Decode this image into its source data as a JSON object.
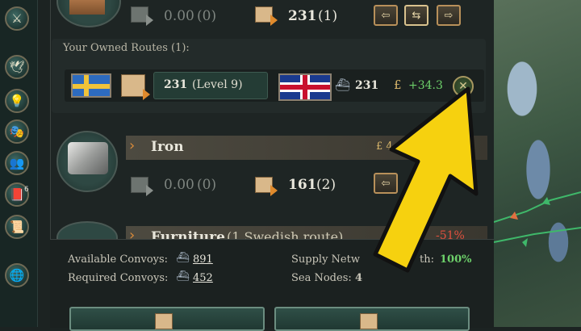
{
  "sidebar": {
    "buttons": [
      {
        "name": "swords-icon",
        "glyph": "⚔"
      },
      {
        "name": "dove-icon",
        "glyph": "🕊"
      },
      {
        "name": "lightbulb-icon",
        "glyph": "💡"
      },
      {
        "name": "masks-icon",
        "glyph": "🎭"
      },
      {
        "name": "people-icon",
        "glyph": "👥"
      },
      {
        "name": "book-icon",
        "glyph": "📕"
      },
      {
        "name": "scroll-icon",
        "glyph": "📜"
      },
      {
        "name": "globe-icon",
        "glyph": "🌐"
      }
    ],
    "book_badge": "6"
  },
  "top_row": {
    "export_value": "0.00",
    "export_count": "(0)",
    "import_value": "231",
    "import_count": "(1)"
  },
  "owned_routes": {
    "label": "Your Owned Routes (1):",
    "route": {
      "amount": "231",
      "level": "(Level 9)",
      "convoys": "231",
      "income": "+34.3",
      "currency": "£"
    }
  },
  "iron": {
    "name": "Iron",
    "price_prefix": "£ 4",
    "export_value": "0.00",
    "export_count": "(0)",
    "import_value": "161",
    "import_count": "(2)"
  },
  "furniture": {
    "name": "Furniture",
    "routes_label": "(1 Swedish route)",
    "percent": "-51%"
  },
  "footer": {
    "available_convoys_label": "Available Convoys:",
    "available_convoys": "891",
    "required_convoys_label": "Required Convoys:",
    "required_convoys": "452",
    "supply_label": "Supply Netw",
    "supply_suffix": "th:",
    "supply_value": "100%",
    "sea_nodes_label": "Sea Nodes:",
    "sea_nodes": "4"
  },
  "colors": {
    "positive": "#6dd16a",
    "negative": "#e2503f",
    "accent_gold": "#b8905a",
    "highlight_arrow": "#f6d10f"
  }
}
